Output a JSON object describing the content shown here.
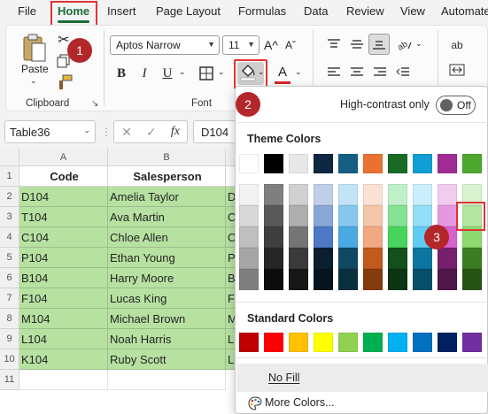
{
  "tabs": [
    "File",
    "Home",
    "Insert",
    "Page Layout",
    "Formulas",
    "Data",
    "Review",
    "View",
    "Automate"
  ],
  "ribbon": {
    "clipboard": {
      "paste_label": "Paste",
      "group_label": "Clipboard"
    },
    "font": {
      "font_name": "Aptos Narrow",
      "font_size": "11",
      "bold": "B",
      "italic": "I",
      "underline": "U",
      "grow_font": "A^",
      "shrink_font": "Aˇ",
      "font_color_letter": "A",
      "group_label": "Font"
    },
    "alignment": {
      "wrap_label": "ab"
    },
    "colors": {
      "font_color_bar": "#d1272c",
      "fill_accent": "#e03434"
    }
  },
  "badges": [
    "1",
    "2",
    "3"
  ],
  "formula_bar": {
    "name_box": "Table36",
    "fx": "fx",
    "cancel": "✕",
    "enter": "✓",
    "formula_value": "D104"
  },
  "grid": {
    "columns": [
      "A",
      "B"
    ],
    "rows": [
      "1",
      "2",
      "3",
      "4",
      "5",
      "6",
      "7",
      "8",
      "9",
      "10",
      "11"
    ],
    "headers": [
      "Code",
      "Salesperson"
    ],
    "records": [
      {
        "code": "D104",
        "salesperson": "Amelia Taylor",
        "c": "D"
      },
      {
        "code": "T104",
        "salesperson": "Ava Martin",
        "c": "C"
      },
      {
        "code": "C104",
        "salesperson": "Chloe Allen",
        "c": "C"
      },
      {
        "code": "P104",
        "salesperson": "Ethan Young",
        "c": "P"
      },
      {
        "code": "B104",
        "salesperson": "Harry Moore",
        "c": "B"
      },
      {
        "code": "F104",
        "salesperson": "Lucas King",
        "c": "F"
      },
      {
        "code": "M104",
        "salesperson": "Michael Brown",
        "c": "M"
      },
      {
        "code": "L104",
        "salesperson": "Noah Harris",
        "c": "L"
      },
      {
        "code": "K104",
        "salesperson": "Ruby Scott",
        "c": "L"
      }
    ],
    "fill_color": "#b7e1a1"
  },
  "dropdown": {
    "high_contrast_label": "High-contrast only",
    "toggle_text": "Off",
    "theme_colors_label": "Theme Colors",
    "standard_colors_label": "Standard Colors",
    "no_fill_label": "No Fill",
    "more_colors_label": "More Colors...",
    "theme_top": [
      "#ffffff",
      "#000000",
      "#e8e8e8",
      "#0e2841",
      "#156082",
      "#e97132",
      "#196b24",
      "#0f9ed5",
      "#a02b93",
      "#4ea72e"
    ],
    "theme_shades": [
      [
        "#f2f2f2",
        "#7f7f7f",
        "#d0d0d0",
        "#c0cee9",
        "#c2e4f6",
        "#fbe2d5",
        "#c1f0c8",
        "#caeefb",
        "#f2cbee",
        "#d9f2d0"
      ],
      [
        "#d8d8d8",
        "#595959",
        "#aeaeae",
        "#89a7d7",
        "#86c7ee",
        "#f6c6ab",
        "#83e293",
        "#95def8",
        "#e598e0",
        "#b4e6a1"
      ],
      [
        "#bfbfbf",
        "#3f3f3f",
        "#757575",
        "#4d78c5",
        "#4aa9e2",
        "#f1a983",
        "#47d45c",
        "#60ccf3",
        "#d761cf",
        "#8fd971"
      ],
      [
        "#a5a5a5",
        "#262626",
        "#3a3a3a",
        "#0a1e30",
        "#104762",
        "#c25a1d",
        "#13501b",
        "#0b76a0",
        "#78206e",
        "#3a7d22"
      ],
      [
        "#7f7f7f",
        "#0c0c0c",
        "#171717",
        "#061420",
        "#0a2f41",
        "#843c0c",
        "#0d3512",
        "#074f6a",
        "#501549",
        "#275317"
      ]
    ],
    "standard": [
      "#c00000",
      "#ff0000",
      "#ffc000",
      "#ffff00",
      "#92d050",
      "#00b050",
      "#00b0f0",
      "#0070c0",
      "#002060",
      "#7030a0"
    ]
  }
}
